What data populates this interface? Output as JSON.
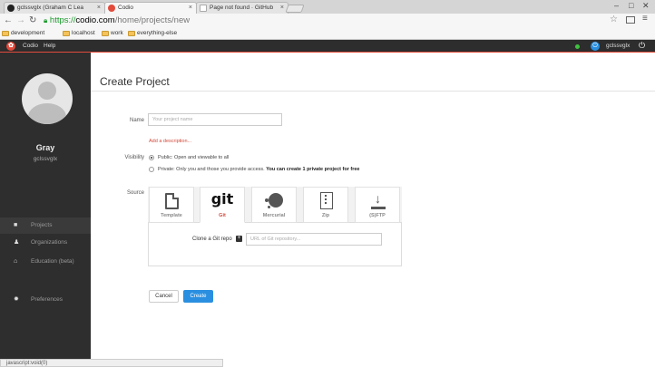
{
  "browser": {
    "tabs": [
      {
        "label": "gclssvglx (Graham C Lea",
        "icon": "github-icon"
      },
      {
        "label": "Codio",
        "icon": "codio-icon"
      },
      {
        "label": "Page not found · GitHub",
        "icon": "page-icon"
      }
    ],
    "url": {
      "scheme": "https://",
      "host": "codio.com",
      "path": "/home/projects/new"
    },
    "bookmarks": [
      "development",
      "localhost",
      "work",
      "everything-else"
    ],
    "status_text": "javascript:void(0)"
  },
  "topbar": {
    "brand": "Codio",
    "menu": [
      "Codio",
      "Help"
    ],
    "username": "gclssvglx",
    "accent": "#e24a3b"
  },
  "sidebar": {
    "display_name": "Gray",
    "handle": "gclssvglx",
    "items": [
      {
        "label": "Projects",
        "icon": "folder-icon"
      },
      {
        "label": "Organizations",
        "icon": "users-icon"
      },
      {
        "label": "Education (beta)",
        "icon": "bank-icon"
      },
      {
        "label": "Preferences",
        "icon": "gear-icon"
      }
    ]
  },
  "page": {
    "title": "Create Project",
    "name_label": "Name",
    "name_placeholder": "Your project name",
    "add_description": "Add a description...",
    "visibility_label": "Visibility",
    "visibility_public": "Public: Open and viewable to all",
    "visibility_private": "Private: Only you and those you provide access.",
    "visibility_private_note": "You can create 1 private project for free",
    "source_label": "Source",
    "sources": [
      "Template",
      "Git",
      "Mercurial",
      "Zip",
      "(S)FTP"
    ],
    "git_logo": "git",
    "clone_label": "Clone a Git repo",
    "clone_placeholder": "URL of Git repository...",
    "cancel_label": "Cancel",
    "create_label": "Create",
    "primary_color": "#2a8fe0"
  }
}
